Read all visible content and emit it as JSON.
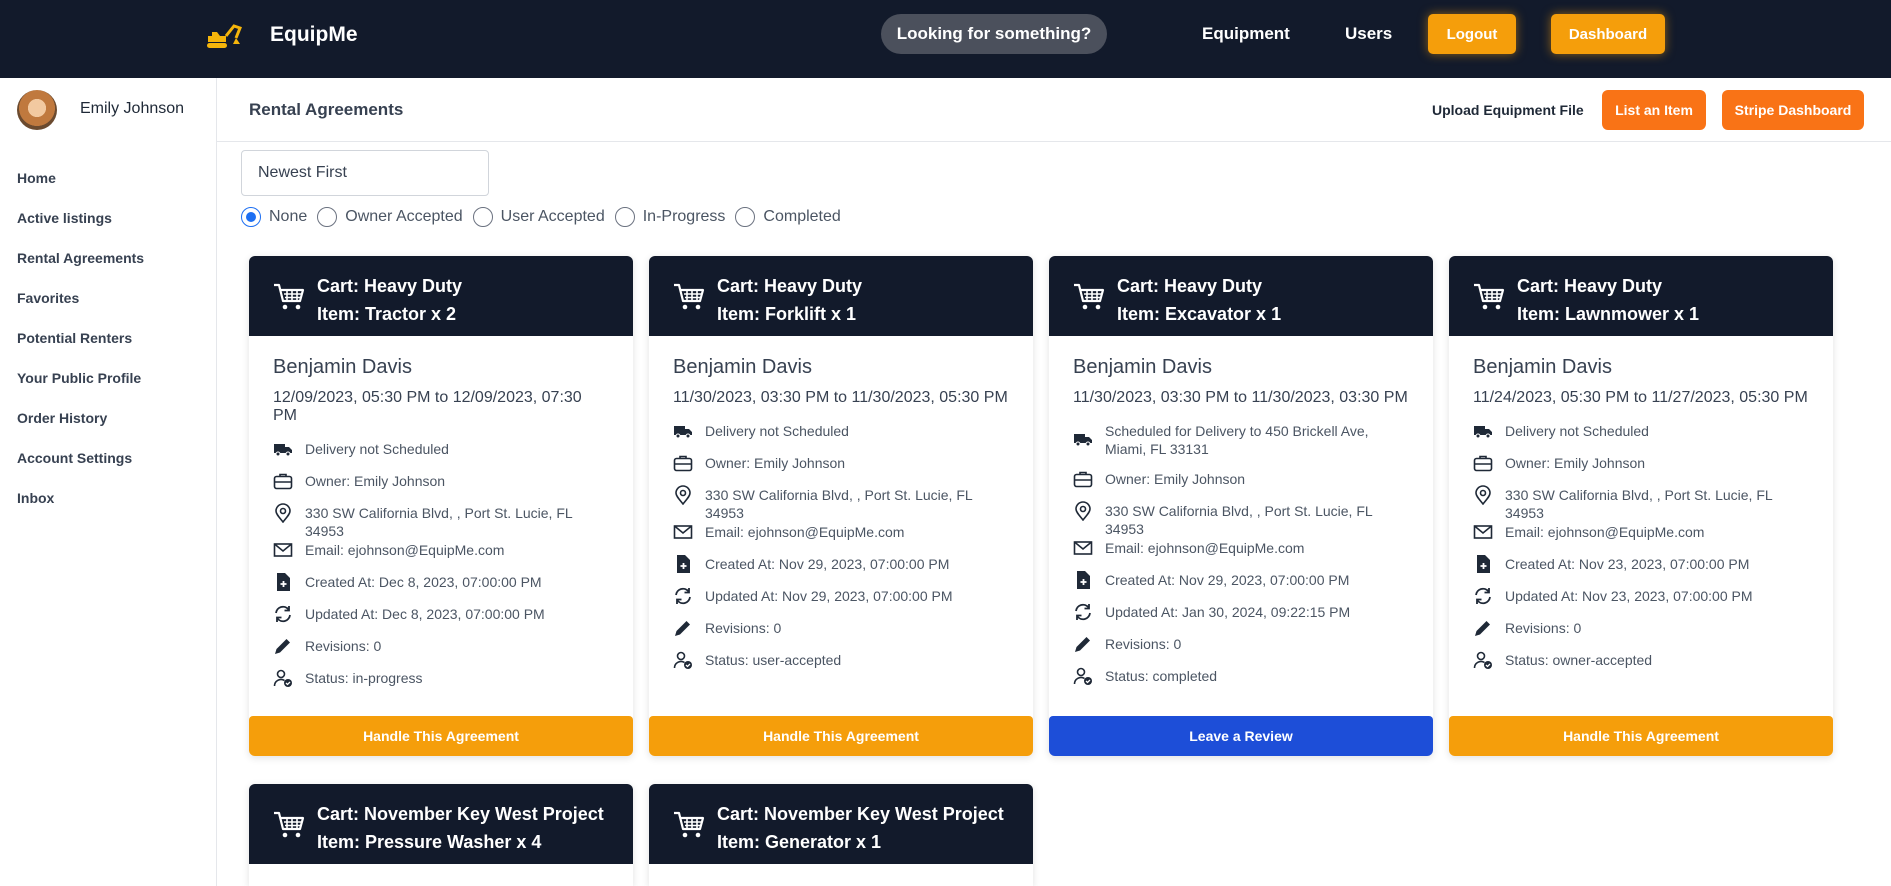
{
  "app": {
    "brand": "EquipMe"
  },
  "topnav": {
    "search_placeholder": "Looking for something?",
    "links": [
      "Equipment",
      "Users"
    ],
    "logout": "Logout",
    "dashboard": "Dashboard"
  },
  "sidebar": {
    "user_name": "Emily Johnson",
    "items": [
      "Home",
      "Active listings",
      "Rental Agreements",
      "Favorites",
      "Potential Renters",
      "Your Public Profile",
      "Order History",
      "Account Settings",
      "Inbox"
    ]
  },
  "header": {
    "title": "Rental Agreements",
    "upload_label": "Upload Equipment File",
    "list_item_label": "List an Item",
    "stripe_label": "Stripe Dashboard"
  },
  "filters": {
    "sort_value": "Newest First",
    "status_options": [
      "None",
      "Owner Accepted",
      "User Accepted",
      "In-Progress",
      "Completed"
    ],
    "selected": "None"
  },
  "cards": [
    {
      "cart": "Cart: Heavy Duty",
      "item": "Item: Tractor x 2",
      "renter": "Benjamin Davis",
      "dates": "12/09/2023, 05:30 PM to 12/09/2023, 07:30 PM",
      "delivery": "Delivery not Scheduled",
      "owner": "Owner: Emily Johnson",
      "address": "330 SW California Blvd, , Port St. Lucie, FL 34953",
      "email": "Email: ejohnson@EquipMe.com",
      "created": "Created At: Dec 8, 2023, 07:00:00 PM",
      "updated": "Updated At: Dec 8, 2023, 07:00:00 PM",
      "revisions": "Revisions: 0",
      "status": "Status: in-progress",
      "button": "Handle This Agreement"
    },
    {
      "cart": "Cart: Heavy Duty",
      "item": "Item: Forklift x 1",
      "renter": "Benjamin Davis",
      "dates": "11/30/2023, 03:30 PM to 11/30/2023, 05:30 PM",
      "delivery": "Delivery not Scheduled",
      "owner": "Owner: Emily Johnson",
      "address": "330 SW California Blvd, , Port St. Lucie, FL 34953",
      "email": "Email: ejohnson@EquipMe.com",
      "created": "Created At: Nov 29, 2023, 07:00:00 PM",
      "updated": "Updated At: Nov 29, 2023, 07:00:00 PM",
      "revisions": "Revisions: 0",
      "status": "Status: user-accepted",
      "button": "Handle This Agreement"
    },
    {
      "cart": "Cart: Heavy Duty",
      "item": "Item: Excavator x 1",
      "renter": "Benjamin Davis",
      "dates": "11/30/2023, 03:30 PM to 11/30/2023, 03:30 PM",
      "delivery": "Scheduled for Delivery to 450 Brickell Ave, Miami, FL 33131",
      "owner": "Owner: Emily Johnson",
      "address": "330 SW California Blvd, , Port St. Lucie, FL 34953",
      "email": "Email: ejohnson@EquipMe.com",
      "created": "Created At: Nov 29, 2023, 07:00:00 PM",
      "updated": "Updated At: Jan 30, 2024, 09:22:15 PM",
      "revisions": "Revisions: 0",
      "status": "Status: completed",
      "button": "Leave a Review"
    },
    {
      "cart": "Cart: Heavy Duty",
      "item": "Item: Lawnmower x 1",
      "renter": "Benjamin Davis",
      "dates": "11/24/2023, 05:30 PM to 11/27/2023, 05:30 PM",
      "delivery": "Delivery not Scheduled",
      "owner": "Owner: Emily Johnson",
      "address": "330 SW California Blvd, , Port St. Lucie, FL 34953",
      "email": "Email: ejohnson@EquipMe.com",
      "created": "Created At: Nov 23, 2023, 07:00:00 PM",
      "updated": "Updated At: Nov 23, 2023, 07:00:00 PM",
      "revisions": "Revisions: 0",
      "status": "Status: owner-accepted",
      "button": "Handle This Agreement"
    },
    {
      "cart": "Cart: November Key West Project",
      "item": "Item: Pressure Washer x 4"
    },
    {
      "cart": "Cart: November Key West Project",
      "item": "Item: Generator x 1"
    }
  ],
  "colors": {
    "nav_bg": "#121a2b",
    "accent_orange": "#f59e0b",
    "header_orange": "#f97316",
    "review_blue": "#1d4ed8",
    "radio_blue": "#1d6ff2"
  }
}
